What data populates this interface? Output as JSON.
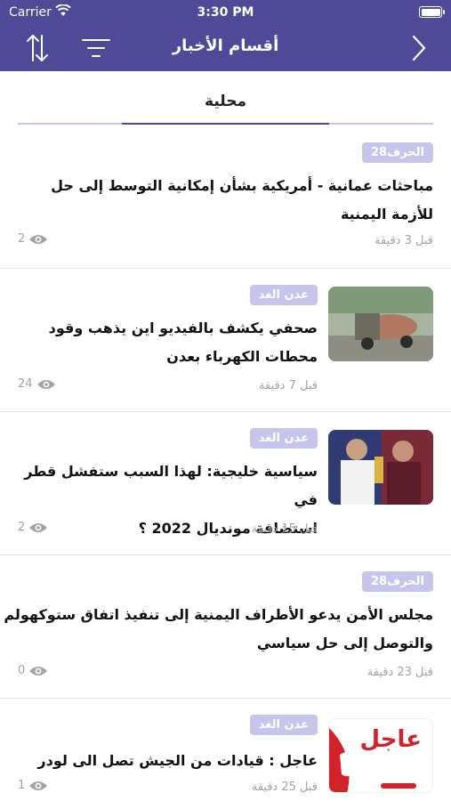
{
  "status": {
    "carrier": "Carrier",
    "time": "3:30 PM"
  },
  "navbar": {
    "title": "أقسام الأخبار",
    "icons": [
      "sort-icon",
      "filter-icon",
      "chevron-right-icon"
    ]
  },
  "tab": {
    "label": "محلية"
  },
  "colors": {
    "primary": "#4f4a97",
    "badge": "#c8c5ec",
    "meta": "#a3a3a3"
  },
  "articles": [
    {
      "source": "الحرف28",
      "title_line1": "مباحثات عمانية - أمريكية بشأن إمكانية التوسط إلى حل",
      "title_line2": "للأزمة اليمنية",
      "time": "قبل 3 دقيقة",
      "views": "2"
    },
    {
      "source": "عدن الغد",
      "title_line1": "صحفي يكشف بالفيديو اين يذهب وقود",
      "title_line2": "محطات الكهرباء بعدن",
      "time": "قبل 7 دقيقة",
      "views": "24"
    },
    {
      "source": "عدن الغد",
      "title_line1": "سياسية خليجية: لهذا السبب ستفشل قطر في",
      "title_line2": "استضافة مونديال 2022 ؟",
      "time": "قبل 15 دقيقة",
      "views": "2"
    },
    {
      "source": "الحرف28",
      "title_line1": "مجلس الأمن يدعو الأطراف اليمنية إلى تنفيذ اتفاق ستوكهولم",
      "title_line2": "والتوصل إلى حل سياسي",
      "time": "قبل 23 دقيقة",
      "views": "0"
    },
    {
      "source": "عدن الغد",
      "title_line1": "عاجل : قيادات من الجيش تصل الى لودر",
      "title_line2": "",
      "time": "قبل 25 دقيقة",
      "views": "1",
      "thumb_text": "عاجل"
    }
  ]
}
